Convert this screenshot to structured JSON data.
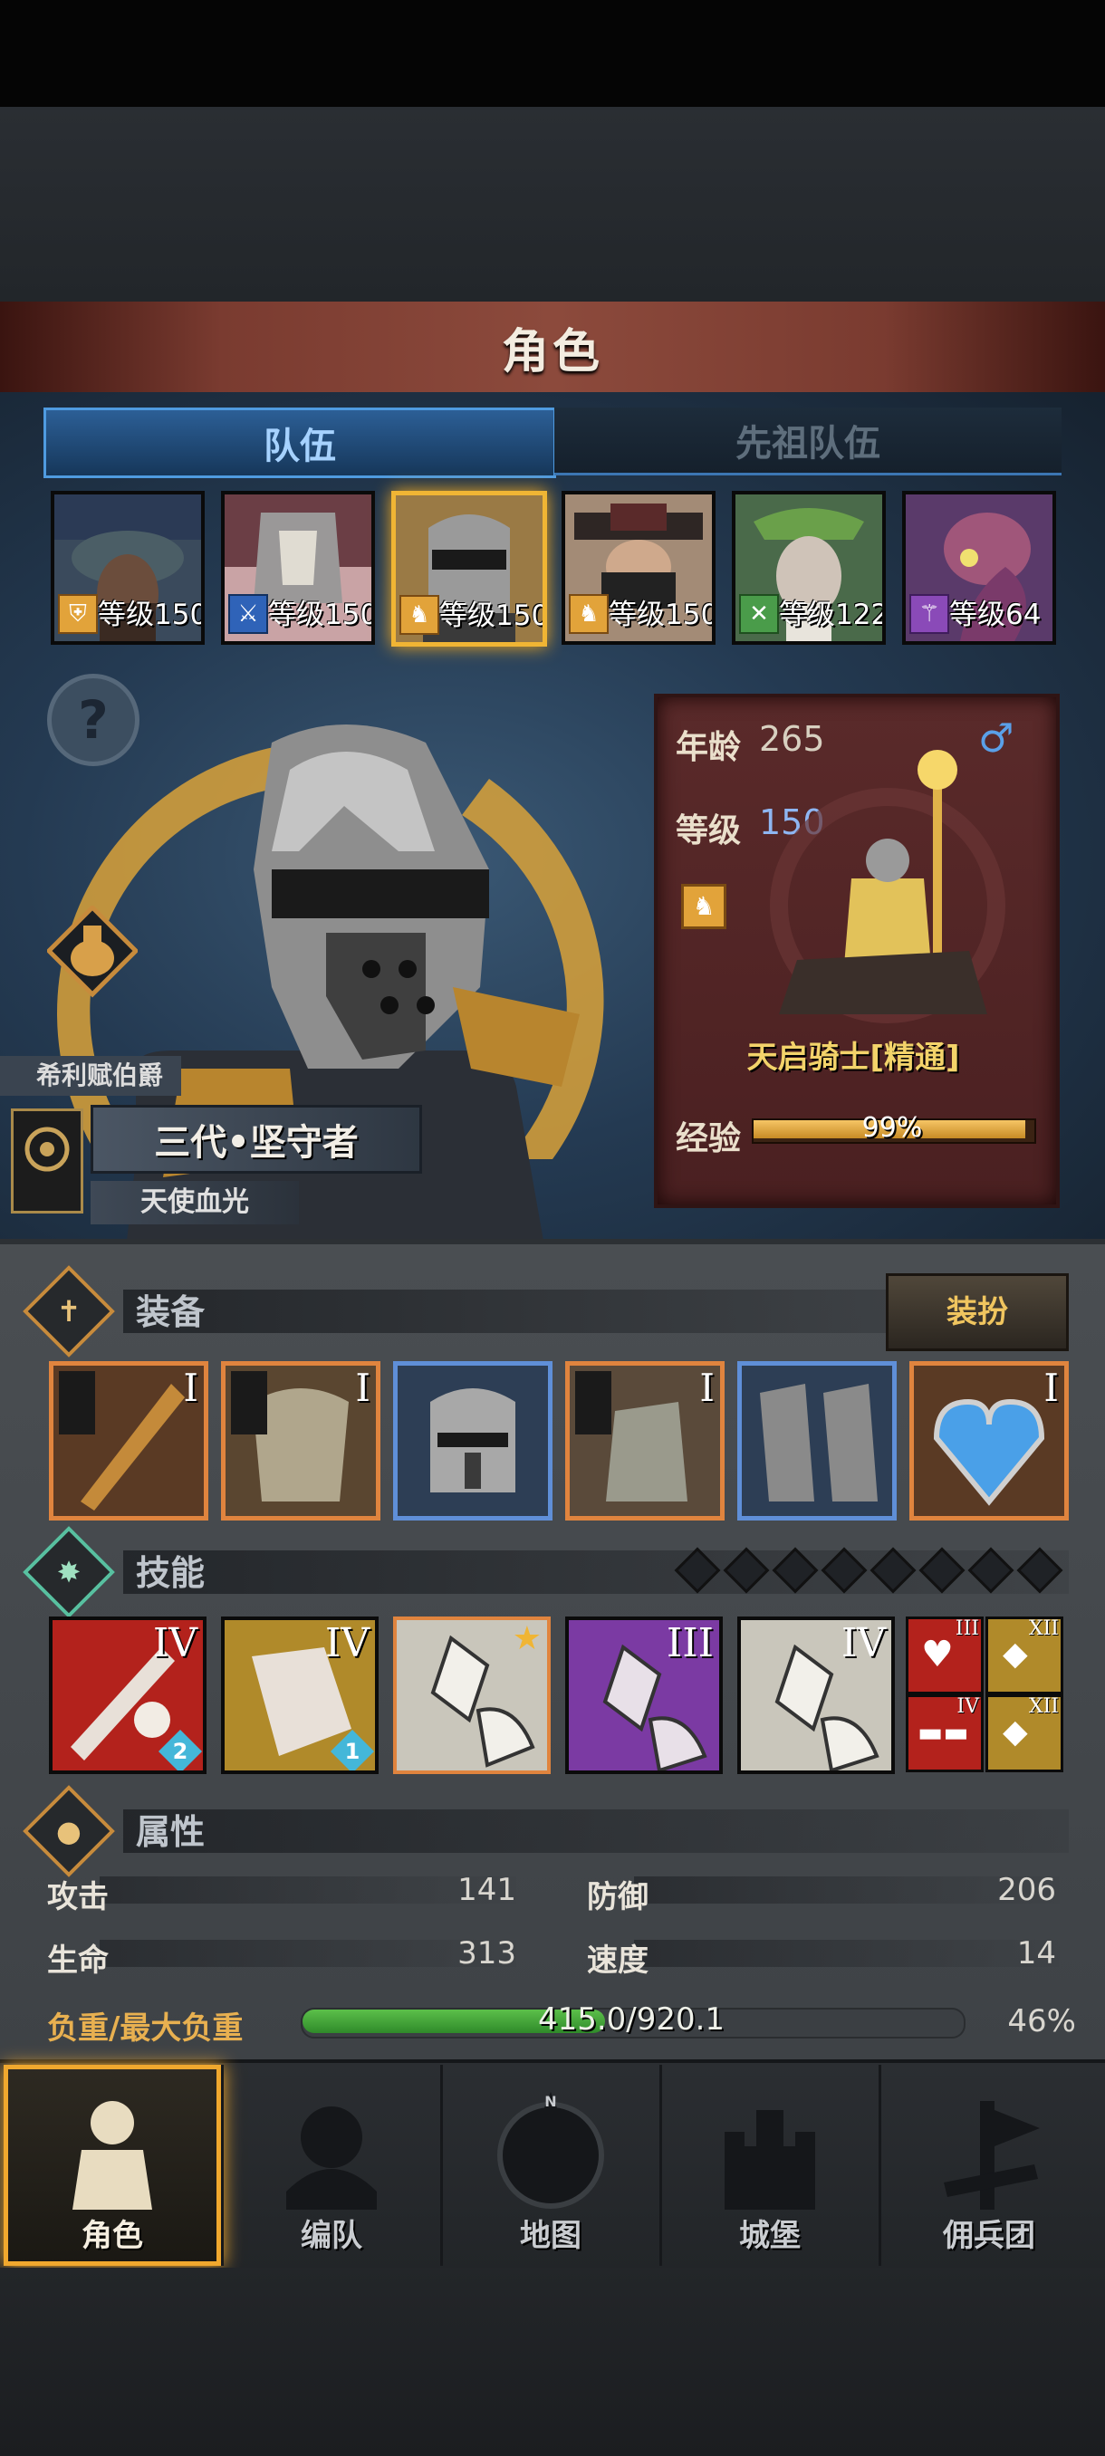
{
  "screen_title": "角色",
  "tabs": [
    {
      "label": "队伍",
      "active": true
    },
    {
      "label": "先祖队伍",
      "active": false
    }
  ],
  "team": [
    {
      "level": "等级150",
      "class_icon": "shield-icon",
      "selected": false
    },
    {
      "level": "等级150",
      "class_icon": "sword-icon",
      "selected": false
    },
    {
      "level": "等级150",
      "class_icon": "horse-icon",
      "selected": true
    },
    {
      "level": "等级150",
      "class_icon": "horse-icon",
      "selected": false
    },
    {
      "level": "等级122",
      "class_icon": "crossed-swords-icon",
      "selected": false
    },
    {
      "level": "等级64",
      "class_icon": "staff-icon",
      "selected": false
    }
  ],
  "hero": {
    "house": "希利赋伯爵",
    "title": "三代•坚守者",
    "bloodline": "天使血光"
  },
  "info": {
    "age_label": "年龄",
    "age": "265",
    "gender_icon": "male-icon",
    "level_label": "等级",
    "level": "150",
    "class_name": "天启骑士[精通]",
    "exp_label": "经验",
    "exp": "99%"
  },
  "equipment": {
    "title": "装备",
    "dress_button": "装扮",
    "items": [
      {
        "name": "weapon",
        "tier": "I",
        "border": "orange"
      },
      {
        "name": "armor",
        "tier": "I",
        "border": "orange"
      },
      {
        "name": "helmet",
        "tier": "",
        "border": "blue"
      },
      {
        "name": "gauntlet",
        "tier": "I",
        "border": "orange"
      },
      {
        "name": "boots",
        "tier": "",
        "border": "blue"
      },
      {
        "name": "amulet",
        "tier": "I",
        "border": "orange"
      }
    ]
  },
  "skills": {
    "title": "技能",
    "slots_total": 8,
    "items": [
      {
        "tier": "IV",
        "badge": "2",
        "bg": "#b3221c"
      },
      {
        "tier": "IV",
        "badge": "1",
        "bg": "#b08a2a"
      },
      {
        "tier": "",
        "badge": "",
        "bg": "#c9c6bb"
      },
      {
        "tier": "III",
        "badge": "",
        "bg": "#7b3aa3"
      },
      {
        "tier": "IV",
        "badge": "",
        "bg": "#c9c6bb"
      }
    ],
    "passives": [
      "III",
      "XII",
      "IV",
      "XII"
    ]
  },
  "attributes": {
    "title": "属性",
    "attack_label": "攻击",
    "attack": "141",
    "defense_label": "防御",
    "defense": "206",
    "hp_label": "生命",
    "hp": "313",
    "speed_label": "速度",
    "speed": "14",
    "load_label": "负重/最大负重",
    "load_value": "415.0/920.1",
    "load_percent": "46%",
    "load_fraction": 0.46
  },
  "nav": [
    {
      "label": "角色",
      "active": true
    },
    {
      "label": "编队",
      "active": false
    },
    {
      "label": "地图",
      "active": false
    },
    {
      "label": "城堡",
      "active": false
    },
    {
      "label": "佣兵团",
      "active": false
    }
  ],
  "colors": {
    "accent_gold": "#f0b534",
    "tab_blue": "#4f9be0",
    "exp_gold": "#e8a83a",
    "load_green": "#4caf3a"
  }
}
